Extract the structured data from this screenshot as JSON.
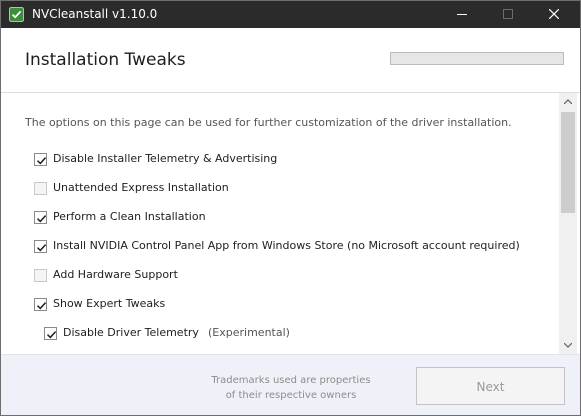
{
  "window": {
    "title": "NVCleanstall v1.10.0",
    "icon": "nvcleanstall-app-icon",
    "controls": [
      "minimize-icon",
      "maximize-icon",
      "close-icon"
    ]
  },
  "header": {
    "title": "Installation Tweaks",
    "progress_fraction": 0
  },
  "content": {
    "description": "The options on this page can be used for further customization of the driver installation.",
    "options": [
      {
        "label": "Disable Installer Telemetry & Advertising",
        "checked": true
      },
      {
        "label": "Unattended Express Installation",
        "checked": false
      },
      {
        "label": "Perform a Clean Installation",
        "checked": true
      },
      {
        "label": "Install NVIDIA Control Panel App from Windows Store (no Microsoft account required)",
        "checked": true
      },
      {
        "label": "Add Hardware Support",
        "checked": false
      },
      {
        "label": "Show Expert Tweaks",
        "checked": true
      },
      {
        "label": "Disable Driver Telemetry",
        "checked": true,
        "note": "(Experimental)",
        "indented": true
      }
    ]
  },
  "footer": {
    "trademark_line1": "Trademarks used are properties",
    "trademark_line2": "of their respective owners",
    "next_label": "Next",
    "next_enabled": false
  },
  "colors": {
    "titlebar": "#2b2b2b",
    "footer_bg": "#eef2f8",
    "check": "#1e1e1e",
    "progress_accent": "#06b025"
  }
}
